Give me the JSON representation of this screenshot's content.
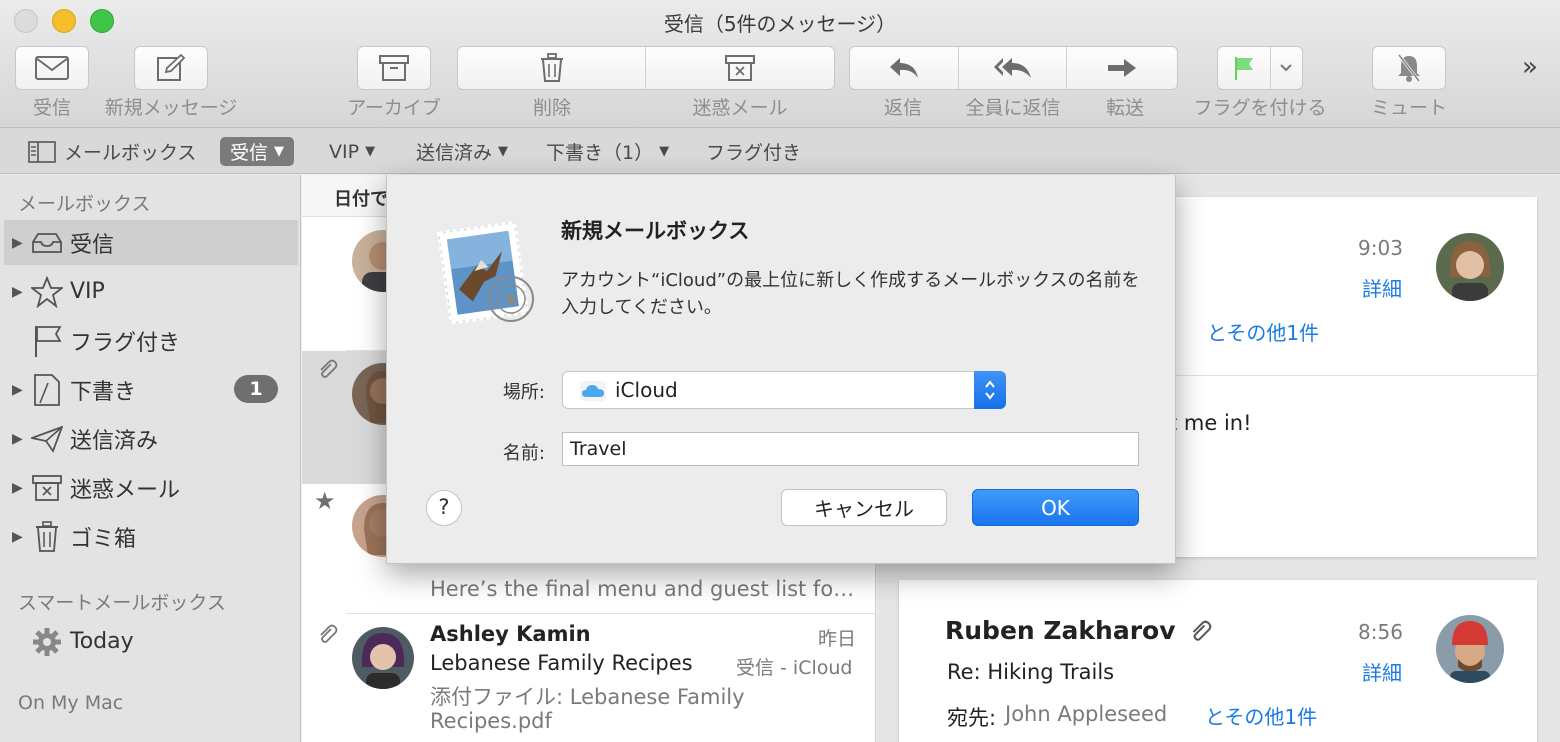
{
  "window": {
    "title": "受信（5件のメッセージ）"
  },
  "toolbar": {
    "get_mail": "受信",
    "new_message": "新規メッセージ",
    "archive": "アーカイブ",
    "delete": "削除",
    "junk": "迷惑メール",
    "reply": "返信",
    "reply_all": "全員に返信",
    "forward": "転送",
    "flag": "フラグを付ける",
    "mute": "ミュート",
    "more": "»"
  },
  "favorites": {
    "mailboxes": "メールボックス",
    "inbox": "受信",
    "vip": "VIP",
    "sent": "送信済み",
    "drafts": "下書き（1）",
    "flagged": "フラグ付き"
  },
  "sidebar": {
    "section_mailboxes": "メールボックス",
    "items": [
      {
        "label": "受信"
      },
      {
        "label": "VIP"
      },
      {
        "label": "フラグ付き"
      },
      {
        "label": "下書き",
        "badge": "1"
      },
      {
        "label": "送信済み"
      },
      {
        "label": "迷惑メール"
      },
      {
        "label": "ゴミ箱"
      }
    ],
    "section_smart": "スマートメールボックス",
    "today": "Today",
    "section_on_my_mac": "On My Mac"
  },
  "message_list": {
    "sort_header": "日付で",
    "preview_snippet": "Here’s the final menu and guest list fo…",
    "ashley": {
      "sender": "Ashley Kamin",
      "date": "昨日",
      "subject": "Lebanese Family Recipes",
      "mailbox": "受信 - iCloud",
      "preview_line1": "添付ファイル: Lebanese Family",
      "preview_line2": "Recipes.pdf"
    }
  },
  "reading_pane": {
    "card1": {
      "time": "9:03",
      "details": "詳細",
      "others": "とその他1件",
      "body_fragment": "t me in!"
    },
    "card2": {
      "sender": "Ruben Zakharov",
      "time": "8:56",
      "subject": "Re: Hiking Trails",
      "details": "詳細",
      "to_label": "宛先:",
      "to_name": "John Appleseed",
      "others": "とその他1件"
    }
  },
  "dialog": {
    "title": "新規メールボックス",
    "message": "アカウント“iCloud”の最上位に新しく作成するメールボックスの名前を入力してください。",
    "location_label": "場所:",
    "location_value": "iCloud",
    "name_label": "名前:",
    "name_value": "Travel",
    "help": "?",
    "cancel": "キャンセル",
    "ok": "OK"
  },
  "colors": {
    "accent": "#1a74ee",
    "link": "#1a7be6",
    "flag_green": "#5fd35f"
  }
}
